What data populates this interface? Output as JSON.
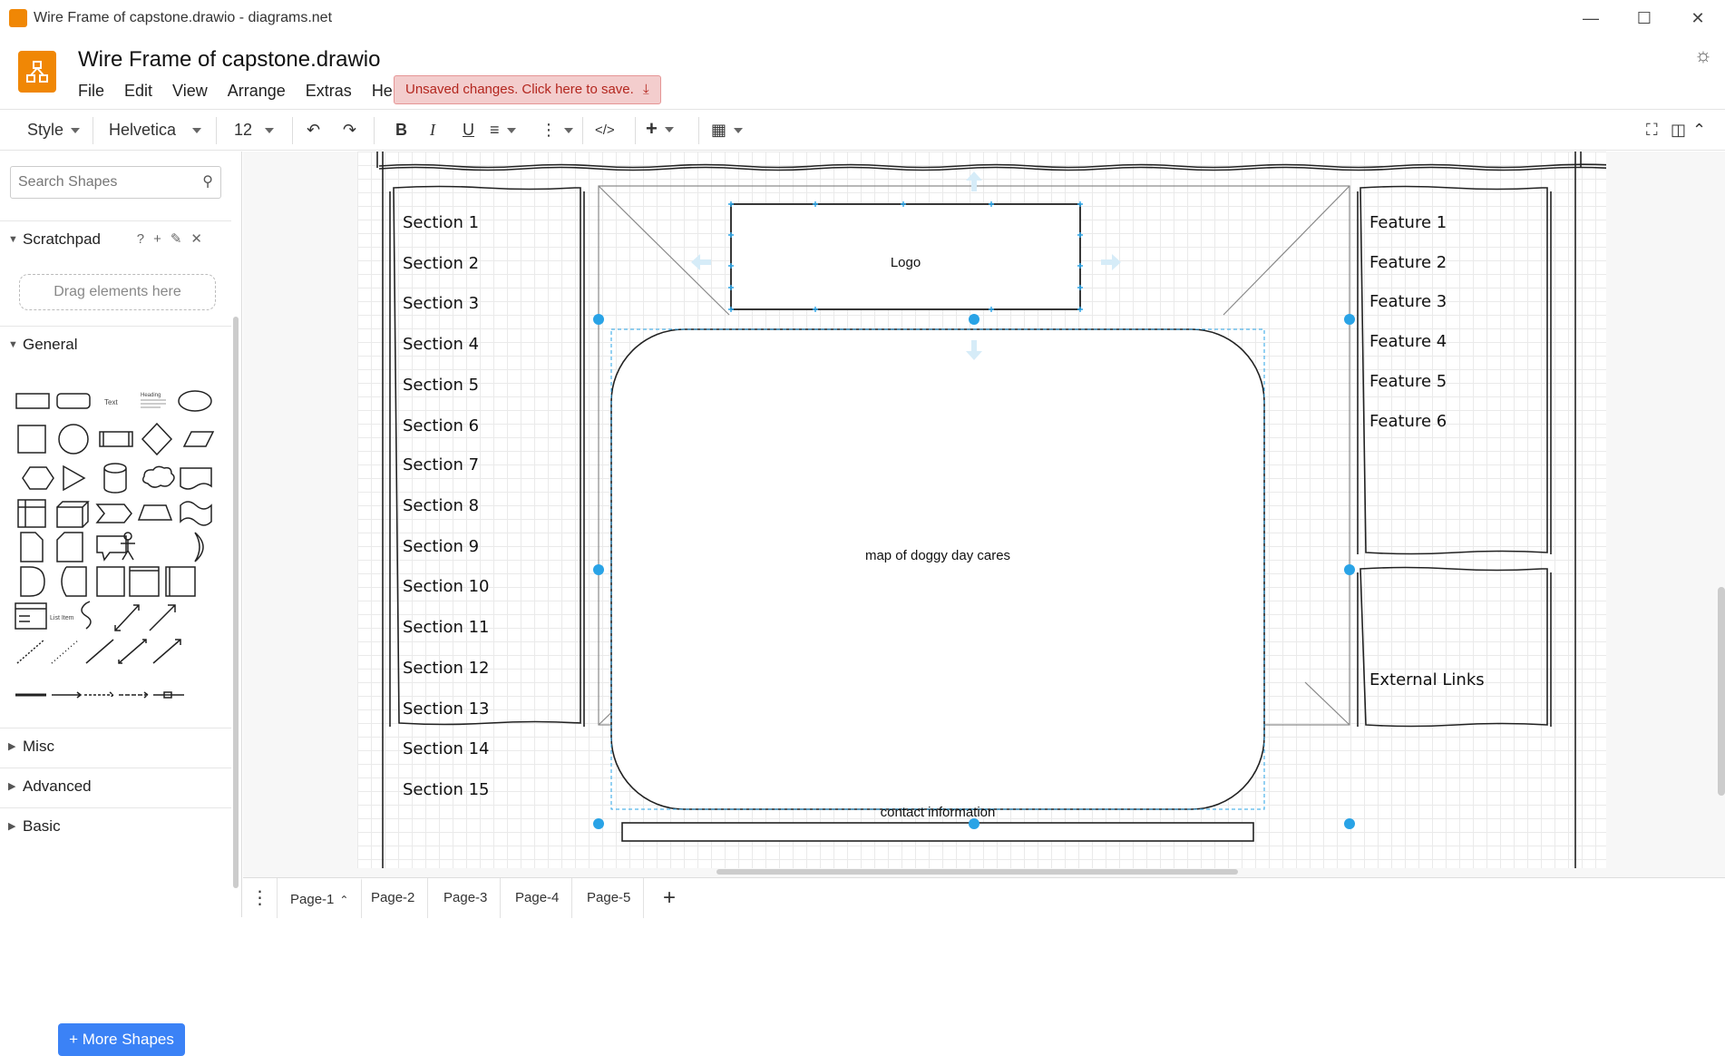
{
  "window": {
    "title": "Wire Frame of capstone.drawio - diagrams.net",
    "minimize": "—",
    "maximize": "☐",
    "close": "✕"
  },
  "header": {
    "doc_title": "Wire Frame of capstone.drawio",
    "menu": [
      "File",
      "Edit",
      "View",
      "Arrange",
      "Extras",
      "Help"
    ],
    "unsaved": "Unsaved changes. Click here to save."
  },
  "toolbar": {
    "style": "Style",
    "font": "Helvetica",
    "font_size": "12",
    "bold": "B",
    "italic": "I",
    "underline": "U",
    "code": "</>"
  },
  "sidebar": {
    "search_placeholder": "Search Shapes",
    "scratchpad": "Scratchpad",
    "drag_here": "Drag elements here",
    "general": "General",
    "sections": [
      "Misc",
      "Advanced",
      "Basic"
    ],
    "more_shapes": "+ More Shapes",
    "text_shape": "Text",
    "heading_shape": "Heading",
    "list_item_shape": "List Item"
  },
  "diagram": {
    "left_sections": [
      "Section 1",
      "Section 2",
      "Section 3",
      "Section 4",
      "Section 5",
      "Section 6",
      "Section 7",
      "Section 8",
      "Section 9",
      "Section 10",
      "Section 11",
      "Section 12",
      "Section 13",
      "Section 14",
      "Section 15"
    ],
    "features": [
      "Feature 1",
      "Feature 2",
      "Feature 3",
      "Feature 4",
      "Feature 5",
      "Feature 6"
    ],
    "external_links": "External Links",
    "logo": "Logo",
    "map": "map of doggy day cares",
    "contact": "contact information"
  },
  "pages": [
    "Page-1",
    "Page-2",
    "Page-3",
    "Page-4",
    "Page-5"
  ],
  "colors": {
    "accent": "#f08705",
    "selection": "#29a3e6",
    "unsaved_bg": "#f3cdcd",
    "button": "#3b82f6"
  }
}
